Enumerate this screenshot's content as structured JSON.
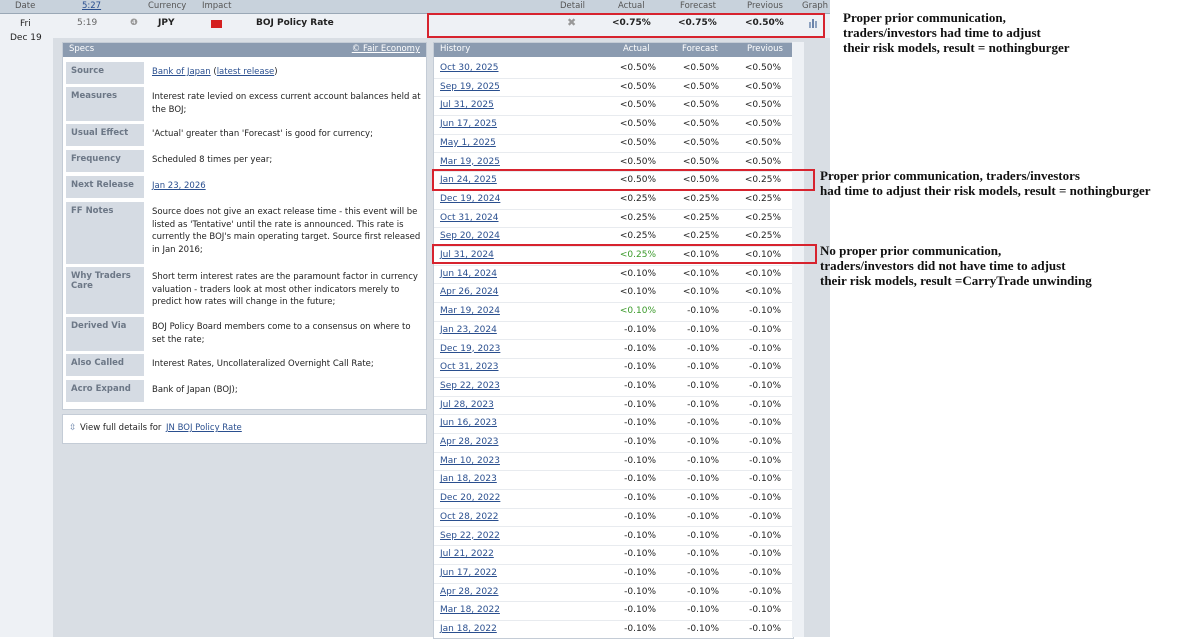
{
  "header": {
    "date": "Date",
    "time": "5:27",
    "currency": "Currency",
    "impact": "Impact",
    "detail": "Detail",
    "actual": "Actual",
    "forecast": "Forecast",
    "previous": "Previous",
    "graph": "Graph"
  },
  "event": {
    "day": "Fri",
    "date": "Dec 19",
    "time": "5:19",
    "currency": "JPY",
    "name": "BOJ Policy Rate",
    "actual": "<0.75%",
    "forecast": "<0.75%",
    "previous": "<0.50%",
    "impact_color": "#d42020"
  },
  "specs": {
    "title": "Specs",
    "credit": "© Fair Economy",
    "rows": [
      {
        "label": "Source",
        "value_link": "Bank of Japan",
        "value_mid": " (",
        "value_link2": "latest release",
        "value_end": ")"
      },
      {
        "label": "Measures",
        "value": "Interest rate levied on excess current account balances held at the BOJ;"
      },
      {
        "label": "Usual Effect",
        "value": "'Actual' greater than 'Forecast' is good for currency;"
      },
      {
        "label": "Frequency",
        "value": "Scheduled 8 times per year;"
      },
      {
        "label": "Next Release",
        "value_link": "Jan 23, 2026"
      },
      {
        "label": "FF Notes",
        "value": "Source does not give an exact release time - this event will be listed as 'Tentative' until the rate is announced. This rate is currently the BOJ's main operating target. Source first released in Jan 2016;"
      },
      {
        "label": "Why Traders Care",
        "value": "Short term interest rates are the paramount factor in currency valuation - traders look at most other indicators merely to predict how rates will change in the future;"
      },
      {
        "label": "Derived Via",
        "value": "BOJ Policy Board members come to a consensus on where to set the rate;"
      },
      {
        "label": "Also Called",
        "value": "Interest Rates, Uncollateralized Overnight Call Rate;"
      },
      {
        "label": "Acro Expand",
        "value": "Bank of Japan (BOJ);"
      }
    ],
    "full_details_prefix": "View full details for",
    "full_details_link": "JN BOJ Policy Rate"
  },
  "history": {
    "title": "History",
    "col_actual": "Actual",
    "col_forecast": "Forecast",
    "col_previous": "Previous",
    "rows": [
      {
        "date": "Oct 30, 2025",
        "actual": "<0.50%",
        "forecast": "<0.50%",
        "previous": "<0.50%"
      },
      {
        "date": "Sep 19, 2025",
        "actual": "<0.50%",
        "forecast": "<0.50%",
        "previous": "<0.50%"
      },
      {
        "date": "Jul 31, 2025",
        "actual": "<0.50%",
        "forecast": "<0.50%",
        "previous": "<0.50%"
      },
      {
        "date": "Jun 17, 2025",
        "actual": "<0.50%",
        "forecast": "<0.50%",
        "previous": "<0.50%"
      },
      {
        "date": "May 1, 2025",
        "actual": "<0.50%",
        "forecast": "<0.50%",
        "previous": "<0.50%"
      },
      {
        "date": "Mar 19, 2025",
        "actual": "<0.50%",
        "forecast": "<0.50%",
        "previous": "<0.50%"
      },
      {
        "date": "Jan 24, 2025",
        "actual": "<0.50%",
        "forecast": "<0.50%",
        "previous": "<0.25%"
      },
      {
        "date": "Dec 19, 2024",
        "actual": "<0.25%",
        "forecast": "<0.25%",
        "previous": "<0.25%"
      },
      {
        "date": "Oct 31, 2024",
        "actual": "<0.25%",
        "forecast": "<0.25%",
        "previous": "<0.25%"
      },
      {
        "date": "Sep 20, 2024",
        "actual": "<0.25%",
        "forecast": "<0.25%",
        "previous": "<0.25%"
      },
      {
        "date": "Jul 31, 2024",
        "actual": "<0.25%",
        "forecast": "<0.10%",
        "previous": "<0.10%",
        "green": true
      },
      {
        "date": "Jun 14, 2024",
        "actual": "<0.10%",
        "forecast": "<0.10%",
        "previous": "<0.10%"
      },
      {
        "date": "Apr 26, 2024",
        "actual": "<0.10%",
        "forecast": "<0.10%",
        "previous": "<0.10%"
      },
      {
        "date": "Mar 19, 2024",
        "actual": "<0.10%",
        "forecast": "-0.10%",
        "previous": "-0.10%",
        "green": true
      },
      {
        "date": "Jan 23, 2024",
        "actual": "-0.10%",
        "forecast": "-0.10%",
        "previous": "-0.10%"
      },
      {
        "date": "Dec 19, 2023",
        "actual": "-0.10%",
        "forecast": "-0.10%",
        "previous": "-0.10%"
      },
      {
        "date": "Oct 31, 2023",
        "actual": "-0.10%",
        "forecast": "-0.10%",
        "previous": "-0.10%"
      },
      {
        "date": "Sep 22, 2023",
        "actual": "-0.10%",
        "forecast": "-0.10%",
        "previous": "-0.10%"
      },
      {
        "date": "Jul 28, 2023",
        "actual": "-0.10%",
        "forecast": "-0.10%",
        "previous": "-0.10%"
      },
      {
        "date": "Jun 16, 2023",
        "actual": "-0.10%",
        "forecast": "-0.10%",
        "previous": "-0.10%"
      },
      {
        "date": "Apr 28, 2023",
        "actual": "-0.10%",
        "forecast": "-0.10%",
        "previous": "-0.10%"
      },
      {
        "date": "Mar 10, 2023",
        "actual": "-0.10%",
        "forecast": "-0.10%",
        "previous": "-0.10%"
      },
      {
        "date": "Jan 18, 2023",
        "actual": "-0.10%",
        "forecast": "-0.10%",
        "previous": "-0.10%"
      },
      {
        "date": "Dec 20, 2022",
        "actual": "-0.10%",
        "forecast": "-0.10%",
        "previous": "-0.10%"
      },
      {
        "date": "Oct 28, 2022",
        "actual": "-0.10%",
        "forecast": "-0.10%",
        "previous": "-0.10%"
      },
      {
        "date": "Sep 22, 2022",
        "actual": "-0.10%",
        "forecast": "-0.10%",
        "previous": "-0.10%"
      },
      {
        "date": "Jul 21, 2022",
        "actual": "-0.10%",
        "forecast": "-0.10%",
        "previous": "-0.10%"
      },
      {
        "date": "Jun 17, 2022",
        "actual": "-0.10%",
        "forecast": "-0.10%",
        "previous": "-0.10%"
      },
      {
        "date": "Apr 28, 2022",
        "actual": "-0.10%",
        "forecast": "-0.10%",
        "previous": "-0.10%"
      },
      {
        "date": "Mar 18, 2022",
        "actual": "-0.10%",
        "forecast": "-0.10%",
        "previous": "-0.10%"
      },
      {
        "date": "Jan 18, 2022",
        "actual": "-0.10%",
        "forecast": "-0.10%",
        "previous": "-0.10%"
      }
    ]
  },
  "annotations": {
    "top": [
      "Proper prior communication,",
      "traders/investors had time to adjust",
      "their risk models, result = nothingburger"
    ],
    "mid": [
      "Proper prior communication, traders/investors",
      "had time to adjust their risk models, result = nothingburger"
    ],
    "low": [
      "No proper prior communication,",
      "traders/investors did not have time to adjust",
      "their risk models, result =CarryTrade unwinding"
    ]
  },
  "colors": {
    "highlight_box": "#d7232e",
    "positive_actual": "#3a9a2a",
    "link": "#2a4f8f"
  }
}
